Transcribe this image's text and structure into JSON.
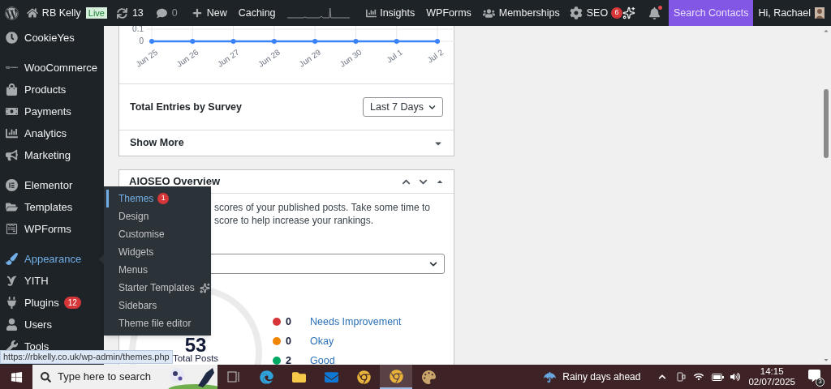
{
  "admin_bar": {
    "site_name": "RB Kelly",
    "live_badge": "Live",
    "updates": "13",
    "comments": "0",
    "new_label": "New",
    "caching": "Caching",
    "insights": "Insights",
    "wpforms": "WPForms",
    "memberships": "Memberships",
    "seo": "SEO",
    "seo_badge": "6",
    "notifications_unread": true,
    "search_contacts": "Search Contacts",
    "greeting": "Hi, Rachael"
  },
  "sidebar": {
    "groups": [
      [
        {
          "label": "CookieYes",
          "selected": false
        }
      ],
      [
        {
          "label": "WooCommerce",
          "selected": false
        },
        {
          "label": "Products",
          "selected": false
        },
        {
          "label": "Payments",
          "selected": false
        },
        {
          "label": "Analytics",
          "selected": false
        },
        {
          "label": "Marketing",
          "selected": false
        }
      ],
      [
        {
          "label": "Elementor",
          "selected": false
        },
        {
          "label": "Templates",
          "selected": false
        },
        {
          "label": "WPForms",
          "selected": false
        }
      ],
      [
        {
          "label": "Appearance",
          "selected": true
        },
        {
          "label": "YITH",
          "selected": false
        },
        {
          "label": "Plugins",
          "selected": false,
          "badge": "12"
        },
        {
          "label": "Users",
          "selected": false
        },
        {
          "label": "Tools",
          "selected": false
        }
      ]
    ]
  },
  "flyout": {
    "items": [
      {
        "label": "Themes",
        "selected": true,
        "badge": "1",
        "kind": "link"
      },
      {
        "label": "Design",
        "selected": false,
        "kind": "link"
      },
      {
        "label": "Customise",
        "selected": false,
        "kind": "link"
      },
      {
        "label": "Widgets",
        "selected": false,
        "kind": "link"
      },
      {
        "label": "Menus",
        "selected": false,
        "kind": "link"
      },
      {
        "label": "Starter Templates",
        "selected": false,
        "kind": "link_with_icon"
      },
      {
        "label": "Sidebars",
        "selected": false,
        "kind": "link"
      },
      {
        "label": "Theme file editor",
        "selected": false,
        "kind": "link"
      }
    ]
  },
  "surveys_card": {
    "chart_data": {
      "type": "line",
      "categories": [
        "Jun 25",
        "Jun 26",
        "Jun 27",
        "Jun 28",
        "Jun 29",
        "Jun 30",
        "Jul 1",
        "Jul 2"
      ],
      "series": [
        {
          "color": "#3b82f6",
          "marker": "circle",
          "values": [
            0,
            0,
            0,
            0,
            0,
            0,
            0,
            0
          ]
        }
      ],
      "ylim": [
        0,
        0.1
      ],
      "yticks": [
        0,
        0.1
      ]
    },
    "entries_title": "Total Entries by Survey",
    "period_select": "Last 7 Days",
    "show_more": "Show More"
  },
  "aioseo": {
    "title": "AIOSEO Overview",
    "description_lines": [
      "scores of your published posts. Take some time to",
      "score to help increase your rankings."
    ],
    "total": "53",
    "total_label": "Total Posts",
    "legend": [
      {
        "count": "0",
        "label": "Needs Improvement",
        "color": "#d63638"
      },
      {
        "count": "0",
        "label": "Okay",
        "color": "#f18500"
      },
      {
        "count": "2",
        "label": "Good",
        "color": "#00aa63"
      }
    ]
  },
  "status_url": "https://rbkelly.co.uk/wp-admin/themes.php",
  "taskbar": {
    "search_placeholder": "Type here to search",
    "apps": [
      {
        "selected": false
      },
      {
        "selected": false
      },
      {
        "selected": false
      },
      {
        "selected": false
      },
      {
        "selected": false
      },
      {
        "selected": true
      },
      {
        "selected": false
      }
    ],
    "weather": "Rainy days ahead",
    "time": "14:15",
    "date": "02/07/2025",
    "notifications": "3"
  }
}
